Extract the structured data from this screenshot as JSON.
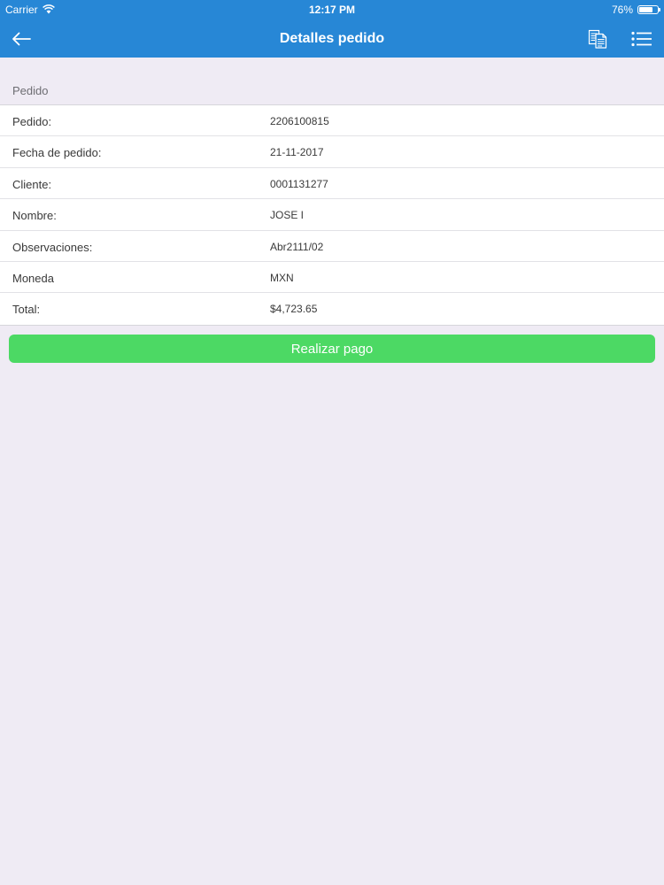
{
  "status_bar": {
    "carrier": "Carrier",
    "time": "12:17 PM",
    "battery": "76%",
    "battery_level": 0.76
  },
  "nav": {
    "title": "Detalles pedido",
    "back_icon": "arrow-left-icon",
    "docs_icon": "documents-icon",
    "menu_icon": "list-menu-icon"
  },
  "section": {
    "title": "Pedido"
  },
  "details": [
    {
      "label": "Pedido:",
      "value": "2206100815"
    },
    {
      "label": "Fecha de pedido:",
      "value": "21-11-2017"
    },
    {
      "label": "Cliente:",
      "value": "0001131277"
    },
    {
      "label": "Nombre:",
      "value": "JOSE I"
    },
    {
      "label": "Observaciones:",
      "value": "Abr2111/02"
    },
    {
      "label": "Moneda",
      "value": "MXN"
    },
    {
      "label": "Total:",
      "value": "$4,723.65"
    }
  ],
  "actions": {
    "pay_label": "Realizar pago"
  },
  "colors": {
    "header": "#2787d6",
    "background": "#efebf4",
    "pay_button": "#4cd964"
  }
}
